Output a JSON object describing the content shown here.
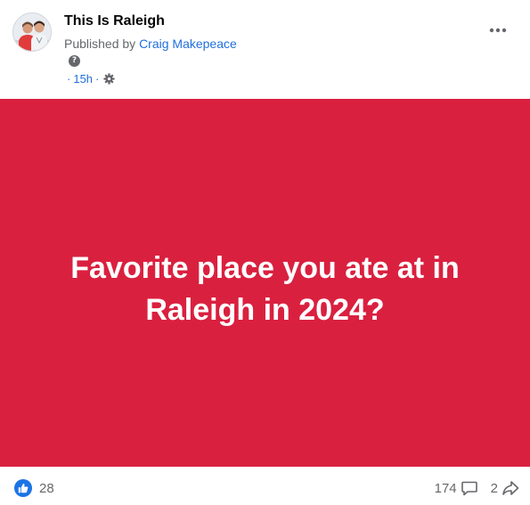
{
  "post": {
    "page_name": "This Is Raleigh",
    "published_prefix": "Published by",
    "author": "Craig Makepeace",
    "help_glyph": "?",
    "dot": "·",
    "time": "15h",
    "audience_icon": "gear-icon",
    "more_icon": "more-horizontal-icon",
    "body": {
      "line1": "Favorite place you ate at in",
      "line2": "Raleigh in 2024?",
      "background_color": "#da203f",
      "text_color": "#ffffff"
    }
  },
  "footer": {
    "reaction_icon": "like-icon",
    "reaction_count": "28",
    "comment_count": "174",
    "comment_icon": "comment-icon",
    "share_count": "2",
    "share_icon": "share-icon"
  },
  "colors": {
    "link": "#216fdb",
    "secondary_text": "#65676b",
    "like_blue": "#1b74e4"
  }
}
